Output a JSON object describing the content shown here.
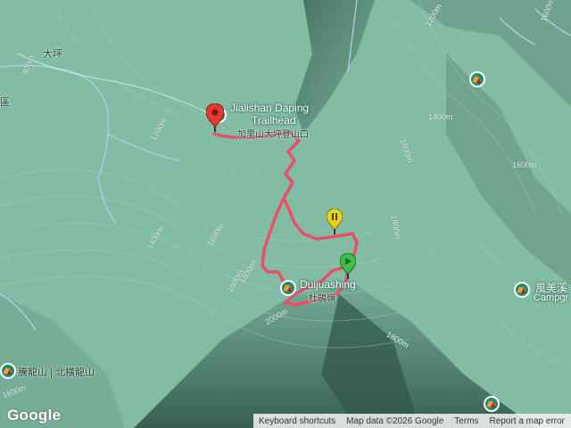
{
  "map": {
    "colors": {
      "terrain": "#7fb9a2",
      "route": "#e8506a",
      "river": "#9ec9e0"
    },
    "places": {
      "daping": "大坪",
      "qu": "區",
      "tenglongshan": "騰龍山 | 北橫龍山"
    },
    "pois": {
      "trailhead_en_1": "Jialishan Daping",
      "trailhead_en_2": "Trailhead",
      "trailhead_zh": "加里山大坪登山口",
      "camp_en": "Duijuashing",
      "camp_zh": "杜鵑嶺",
      "fengmei_zh": "風美溪",
      "fengmei_en": "Campgr"
    },
    "contours": [
      "800m",
      "1200m",
      "1600m",
      "1400m",
      "1600m",
      "1800m",
      "2000m",
      "1800m",
      "1600m",
      "1200m",
      "1400m",
      "1600m",
      "1800m",
      "1600m",
      "1600m"
    ],
    "icons": {
      "start_marker": "red-location-pin",
      "waypoint_yellow": "yellow-location-pin",
      "waypoint_green": "green-location-pin",
      "campground": "campground-icon"
    },
    "google_logo": "Google",
    "footer": {
      "keyboard_shortcuts": "Keyboard shortcuts",
      "map_data": "Map data ©2026 Google",
      "terms": "Terms",
      "report": "Report a map error"
    }
  }
}
